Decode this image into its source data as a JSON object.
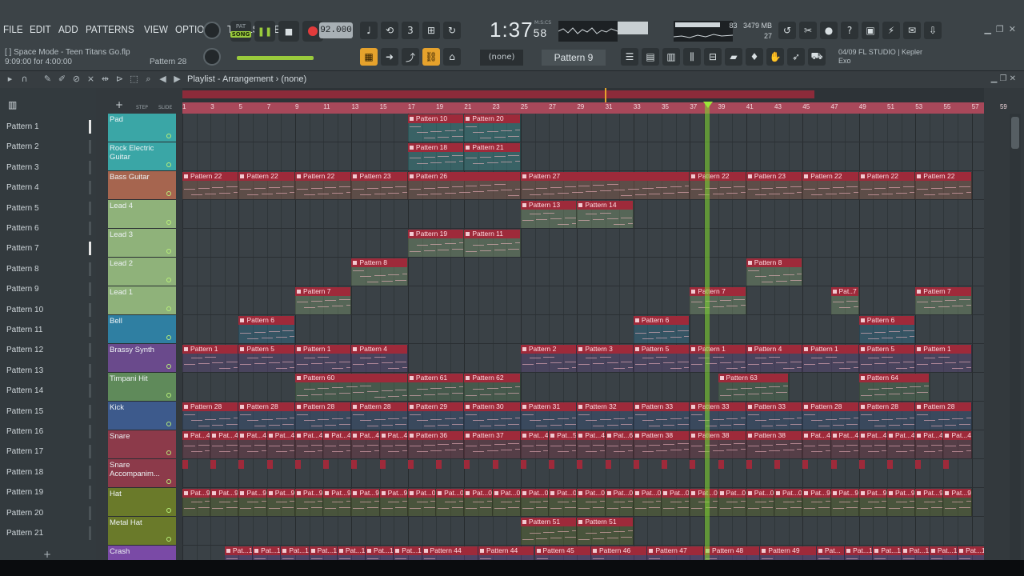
{
  "menu": [
    "FILE",
    "EDIT",
    "ADD",
    "PATTERNS",
    "VIEW",
    "OPTIONS",
    "TOOLS",
    "HELP"
  ],
  "song": {
    "title": "Space Mode - Teen Titans Go.flp",
    "bracket": "[ ]",
    "position": "9:09:00 for 4:00:00",
    "pattern_hint": "Pattern 28"
  },
  "transport": {
    "pat_label": "PAT",
    "song_label": "SONG",
    "tempo": "92.000",
    "time": "1:37",
    "time_cs": "58",
    "time_unit": "M:S:CS"
  },
  "system": {
    "cpu": "83",
    "memory": "3479 MB",
    "polyphony": "27"
  },
  "news": {
    "line1": "04/09  FL STUDIO | Kepler",
    "line2": "Exo"
  },
  "pattern_selector": {
    "current": "Pattern 9",
    "arp": "(none)"
  },
  "playlist": {
    "title": "Playlist - Arrangement",
    "subtitle": "(none)"
  },
  "pattern_list": [
    "Pattern 1",
    "Pattern 2",
    "Pattern 3",
    "Pattern 4",
    "Pattern 5",
    "Pattern 6",
    "Pattern 7",
    "Pattern 8",
    "Pattern 9",
    "Pattern 10",
    "Pattern 11",
    "Pattern 12",
    "Pattern 13",
    "Pattern 14",
    "Pattern 15",
    "Pattern 16",
    "Pattern 17",
    "Pattern 18",
    "Pattern 19",
    "Pattern 20",
    "Pattern 21"
  ],
  "ruler": [
    "1",
    "3",
    "5",
    "7",
    "9",
    "11",
    "13",
    "15",
    "17",
    "19",
    "21",
    "23",
    "25",
    "27",
    "29",
    "31",
    "33",
    "35",
    "37",
    "39",
    "41",
    "43",
    "45",
    "47",
    "49",
    "51",
    "53",
    "55",
    "57",
    "59"
  ],
  "ruler_small": {
    "step": "STEP",
    "slide": "SLIDE"
  },
  "tracks": [
    {
      "name": "Pad",
      "color": "#3aa6a6"
    },
    {
      "name": "Rock Electric Guitar",
      "color": "#3aa6a6"
    },
    {
      "name": "Bass Guitar",
      "color": "#a6654f"
    },
    {
      "name": "Lead 4",
      "color": "#8fb27a"
    },
    {
      "name": "Lead 3",
      "color": "#8fb27a"
    },
    {
      "name": "Lead 2",
      "color": "#8fb27a"
    },
    {
      "name": "Lead 1",
      "color": "#8fb27a"
    },
    {
      "name": "Bell",
      "color": "#2f7fa2"
    },
    {
      "name": "Brassy Synth",
      "color": "#6a4a8c"
    },
    {
      "name": "Timpani Hit",
      "color": "#5f8a5a"
    },
    {
      "name": "Kick",
      "color": "#3d5a8c"
    },
    {
      "name": "Snare",
      "color": "#8c3a4a"
    },
    {
      "name": "Snare Accompanim...",
      "color": "#8c3a4a"
    },
    {
      "name": "Hat",
      "color": "#6a7a2a"
    },
    {
      "name": "Metal Hat",
      "color": "#6a7a2a"
    },
    {
      "name": "Crash",
      "color": "#7a4aa6"
    }
  ],
  "clips": [
    {
      "t": 0,
      "b": 17,
      "len": 4,
      "label": "Pattern 10"
    },
    {
      "t": 0,
      "b": 21,
      "len": 4,
      "label": "Pattern 20"
    },
    {
      "t": 1,
      "b": 17,
      "len": 4,
      "label": "Pattern 18"
    },
    {
      "t": 1,
      "b": 21,
      "len": 4,
      "label": "Pattern 21"
    },
    {
      "t": 2,
      "b": 1,
      "len": 4,
      "label": "Pattern 22"
    },
    {
      "t": 2,
      "b": 5,
      "len": 4,
      "label": "Pattern 22"
    },
    {
      "t": 2,
      "b": 9,
      "len": 4,
      "label": "Pattern 22"
    },
    {
      "t": 2,
      "b": 13,
      "len": 4,
      "label": "Pattern 23"
    },
    {
      "t": 2,
      "b": 17,
      "len": 8,
      "label": "Pattern 26"
    },
    {
      "t": 2,
      "b": 25,
      "len": 12,
      "label": "Pattern 27"
    },
    {
      "t": 2,
      "b": 37,
      "len": 4,
      "label": "Pattern 22"
    },
    {
      "t": 2,
      "b": 41,
      "len": 4,
      "label": "Pattern 23"
    },
    {
      "t": 2,
      "b": 45,
      "len": 4,
      "label": "Pattern 22"
    },
    {
      "t": 2,
      "b": 49,
      "len": 4,
      "label": "Pattern 22"
    },
    {
      "t": 2,
      "b": 53,
      "len": 4,
      "label": "Pattern 22"
    },
    {
      "t": 3,
      "b": 25,
      "len": 4,
      "label": "Pattern 13"
    },
    {
      "t": 3,
      "b": 29,
      "len": 4,
      "label": "Pattern 14"
    },
    {
      "t": 4,
      "b": 17,
      "len": 4,
      "label": "Pattern 19"
    },
    {
      "t": 4,
      "b": 21,
      "len": 4,
      "label": "Pattern 11"
    },
    {
      "t": 5,
      "b": 13,
      "len": 4,
      "label": "Pattern 8"
    },
    {
      "t": 5,
      "b": 41,
      "len": 4,
      "label": "Pattern 8"
    },
    {
      "t": 6,
      "b": 9,
      "len": 4,
      "label": "Pattern 7"
    },
    {
      "t": 6,
      "b": 37,
      "len": 4,
      "label": "Pattern 7"
    },
    {
      "t": 6,
      "b": 47,
      "len": 2,
      "label": "Pat..7"
    },
    {
      "t": 6,
      "b": 53,
      "len": 4,
      "label": "Pattern 7"
    },
    {
      "t": 7,
      "b": 5,
      "len": 4,
      "label": "Pattern 6"
    },
    {
      "t": 7,
      "b": 33,
      "len": 4,
      "label": "Pattern 6"
    },
    {
      "t": 7,
      "b": 49,
      "len": 4,
      "label": "Pattern 6"
    },
    {
      "t": 8,
      "b": 1,
      "len": 4,
      "label": "Pattern 1"
    },
    {
      "t": 8,
      "b": 5,
      "len": 4,
      "label": "Pattern 5"
    },
    {
      "t": 8,
      "b": 9,
      "len": 4,
      "label": "Pattern 1"
    },
    {
      "t": 8,
      "b": 13,
      "len": 4,
      "label": "Pattern 4"
    },
    {
      "t": 8,
      "b": 25,
      "len": 4,
      "label": "Pattern 2"
    },
    {
      "t": 8,
      "b": 29,
      "len": 4,
      "label": "Pattern 3"
    },
    {
      "t": 8,
      "b": 33,
      "len": 4,
      "label": "Pattern 5"
    },
    {
      "t": 8,
      "b": 37,
      "len": 4,
      "label": "Pattern 1"
    },
    {
      "t": 8,
      "b": 41,
      "len": 4,
      "label": "Pattern 4"
    },
    {
      "t": 8,
      "b": 45,
      "len": 4,
      "label": "Pattern 1"
    },
    {
      "t": 8,
      "b": 49,
      "len": 4,
      "label": "Pattern 5"
    },
    {
      "t": 8,
      "b": 53,
      "len": 4,
      "label": "Pattern 1"
    },
    {
      "t": 9,
      "b": 9,
      "len": 8,
      "label": "Pattern 60"
    },
    {
      "t": 9,
      "b": 17,
      "len": 4,
      "label": "Pattern 61"
    },
    {
      "t": 9,
      "b": 21,
      "len": 4,
      "label": "Pattern 62"
    },
    {
      "t": 9,
      "b": 39,
      "len": 5,
      "label": "Pattern 63"
    },
    {
      "t": 9,
      "b": 49,
      "len": 5,
      "label": "Pattern 64"
    },
    {
      "t": 10,
      "b": 1,
      "len": 4,
      "label": "Pattern 28"
    },
    {
      "t": 10,
      "b": 5,
      "len": 4,
      "label": "Pattern 28"
    },
    {
      "t": 10,
      "b": 9,
      "len": 4,
      "label": "Pattern 28"
    },
    {
      "t": 10,
      "b": 13,
      "len": 4,
      "label": "Pattern 28"
    },
    {
      "t": 10,
      "b": 17,
      "len": 4,
      "label": "Pattern 29"
    },
    {
      "t": 10,
      "b": 21,
      "len": 4,
      "label": "Pattern 30"
    },
    {
      "t": 10,
      "b": 25,
      "len": 4,
      "label": "Pattern 31"
    },
    {
      "t": 10,
      "b": 29,
      "len": 4,
      "label": "Pattern 32"
    },
    {
      "t": 10,
      "b": 33,
      "len": 4,
      "label": "Pattern 33"
    },
    {
      "t": 10,
      "b": 37,
      "len": 4,
      "label": "Pattern 33"
    },
    {
      "t": 10,
      "b": 41,
      "len": 4,
      "label": "Pattern 33"
    },
    {
      "t": 10,
      "b": 45,
      "len": 4,
      "label": "Pattern 28"
    },
    {
      "t": 10,
      "b": 49,
      "len": 4,
      "label": "Pattern 28"
    },
    {
      "t": 10,
      "b": 53,
      "len": 4,
      "label": "Pattern 28"
    },
    {
      "t": 11,
      "b": 1,
      "len": 2,
      "label": "Pat...4"
    },
    {
      "t": 11,
      "b": 3,
      "len": 2,
      "label": "Pat...4"
    },
    {
      "t": 11,
      "b": 5,
      "len": 2,
      "label": "Pat...4"
    },
    {
      "t": 11,
      "b": 7,
      "len": 2,
      "label": "Pat...4"
    },
    {
      "t": 11,
      "b": 9,
      "len": 2,
      "label": "Pat...4"
    },
    {
      "t": 11,
      "b": 11,
      "len": 2,
      "label": "Pat...4"
    },
    {
      "t": 11,
      "b": 13,
      "len": 2,
      "label": "Pat...4"
    },
    {
      "t": 11,
      "b": 15,
      "len": 2,
      "label": "Pat...4"
    },
    {
      "t": 11,
      "b": 17,
      "len": 4,
      "label": "Pattern 36"
    },
    {
      "t": 11,
      "b": 21,
      "len": 4,
      "label": "Pattern 37"
    },
    {
      "t": 11,
      "b": 25,
      "len": 2,
      "label": "Pat...4"
    },
    {
      "t": 11,
      "b": 27,
      "len": 2,
      "label": "Pat...5"
    },
    {
      "t": 11,
      "b": 29,
      "len": 2,
      "label": "Pat...4"
    },
    {
      "t": 11,
      "b": 31,
      "len": 2,
      "label": "Pat...6"
    },
    {
      "t": 11,
      "b": 33,
      "len": 4,
      "label": "Pattern 38"
    },
    {
      "t": 11,
      "b": 37,
      "len": 4,
      "label": "Pattern 38"
    },
    {
      "t": 11,
      "b": 41,
      "len": 4,
      "label": "Pattern 38"
    },
    {
      "t": 11,
      "b": 45,
      "len": 2,
      "label": "Pat...4"
    },
    {
      "t": 11,
      "b": 47,
      "len": 2,
      "label": "Pat...4"
    },
    {
      "t": 11,
      "b": 49,
      "len": 2,
      "label": "Pat...4"
    },
    {
      "t": 11,
      "b": 51,
      "len": 2,
      "label": "Pat...4"
    },
    {
      "t": 11,
      "b": 53,
      "len": 2,
      "label": "Pat...4"
    },
    {
      "t": 11,
      "b": 55,
      "len": 2,
      "label": "Pat...4"
    },
    {
      "t": 13,
      "b": 1,
      "len": 2,
      "label": "Pat...9"
    },
    {
      "t": 13,
      "b": 3,
      "len": 2,
      "label": "Pat...9"
    },
    {
      "t": 13,
      "b": 5,
      "len": 2,
      "label": "Pat...9"
    },
    {
      "t": 13,
      "b": 7,
      "len": 2,
      "label": "Pat...9"
    },
    {
      "t": 13,
      "b": 9,
      "len": 2,
      "label": "Pat...9"
    },
    {
      "t": 13,
      "b": 11,
      "len": 2,
      "label": "Pat...9"
    },
    {
      "t": 13,
      "b": 13,
      "len": 2,
      "label": "Pat...9"
    },
    {
      "t": 13,
      "b": 15,
      "len": 2,
      "label": "Pat...9"
    },
    {
      "t": 13,
      "b": 17,
      "len": 2,
      "label": "Pat...0"
    },
    {
      "t": 13,
      "b": 19,
      "len": 2,
      "label": "Pat...0"
    },
    {
      "t": 13,
      "b": 21,
      "len": 2,
      "label": "Pat...0"
    },
    {
      "t": 13,
      "b": 23,
      "len": 2,
      "label": "Pat...0"
    },
    {
      "t": 13,
      "b": 25,
      "len": 2,
      "label": "Pat...0"
    },
    {
      "t": 13,
      "b": 27,
      "len": 2,
      "label": "Pat...0"
    },
    {
      "t": 13,
      "b": 29,
      "len": 2,
      "label": "Pat...0"
    },
    {
      "t": 13,
      "b": 31,
      "len": 2,
      "label": "Pat...0"
    },
    {
      "t": 13,
      "b": 33,
      "len": 2,
      "label": "Pat...0"
    },
    {
      "t": 13,
      "b": 35,
      "len": 2,
      "label": "Pat...0"
    },
    {
      "t": 13,
      "b": 37,
      "len": 2,
      "label": "Pat...0"
    },
    {
      "t": 13,
      "b": 39,
      "len": 2,
      "label": "Pat...0"
    },
    {
      "t": 13,
      "b": 41,
      "len": 2,
      "label": "Pat...0"
    },
    {
      "t": 13,
      "b": 43,
      "len": 2,
      "label": "Pat...0"
    },
    {
      "t": 13,
      "b": 45,
      "len": 2,
      "label": "Pat...9"
    },
    {
      "t": 13,
      "b": 47,
      "len": 2,
      "label": "Pat...9"
    },
    {
      "t": 13,
      "b": 49,
      "len": 2,
      "label": "Pat...9"
    },
    {
      "t": 13,
      "b": 51,
      "len": 2,
      "label": "Pat...9"
    },
    {
      "t": 13,
      "b": 53,
      "len": 2,
      "label": "Pat...9"
    },
    {
      "t": 13,
      "b": 55,
      "len": 2,
      "label": "Pat...9"
    },
    {
      "t": 14,
      "b": 25,
      "len": 4,
      "label": "Pattern 51"
    },
    {
      "t": 14,
      "b": 29,
      "len": 4,
      "label": "Pattern 51"
    },
    {
      "t": 15,
      "b": 4,
      "len": 2,
      "label": "Pat...1"
    },
    {
      "t": 15,
      "b": 6,
      "len": 2,
      "label": "Pat...1"
    },
    {
      "t": 15,
      "b": 8,
      "len": 2,
      "label": "Pat...1"
    },
    {
      "t": 15,
      "b": 10,
      "len": 2,
      "label": "Pat...1"
    },
    {
      "t": 15,
      "b": 12,
      "len": 2,
      "label": "Pat...1"
    },
    {
      "t": 15,
      "b": 14,
      "len": 2,
      "label": "Pat...1"
    },
    {
      "t": 15,
      "b": 16,
      "len": 2,
      "label": "Pat...1"
    },
    {
      "t": 15,
      "b": 18,
      "len": 4,
      "label": "Pattern 44"
    },
    {
      "t": 15,
      "b": 22,
      "len": 4,
      "label": "Pattern 44"
    },
    {
      "t": 15,
      "b": 26,
      "len": 4,
      "label": "Pattern 45"
    },
    {
      "t": 15,
      "b": 30,
      "len": 4,
      "label": "Pattern 46"
    },
    {
      "t": 15,
      "b": 34,
      "len": 4,
      "label": "Pattern 47"
    },
    {
      "t": 15,
      "b": 38,
      "len": 4,
      "label": "Pattern 48"
    },
    {
      "t": 15,
      "b": 42,
      "len": 4,
      "label": "Pattern 49"
    },
    {
      "t": 15,
      "b": 46,
      "len": 2,
      "label": "Pat..."
    },
    {
      "t": 15,
      "b": 48,
      "len": 2,
      "label": "Pat...1"
    },
    {
      "t": 15,
      "b": 50,
      "len": 2,
      "label": "Pat...1"
    },
    {
      "t": 15,
      "b": 52,
      "len": 2,
      "label": "Pat...1"
    },
    {
      "t": 15,
      "b": 54,
      "len": 2,
      "label": "Pat...1"
    },
    {
      "t": 15,
      "b": 56,
      "len": 2,
      "label": "Pat...1"
    }
  ]
}
